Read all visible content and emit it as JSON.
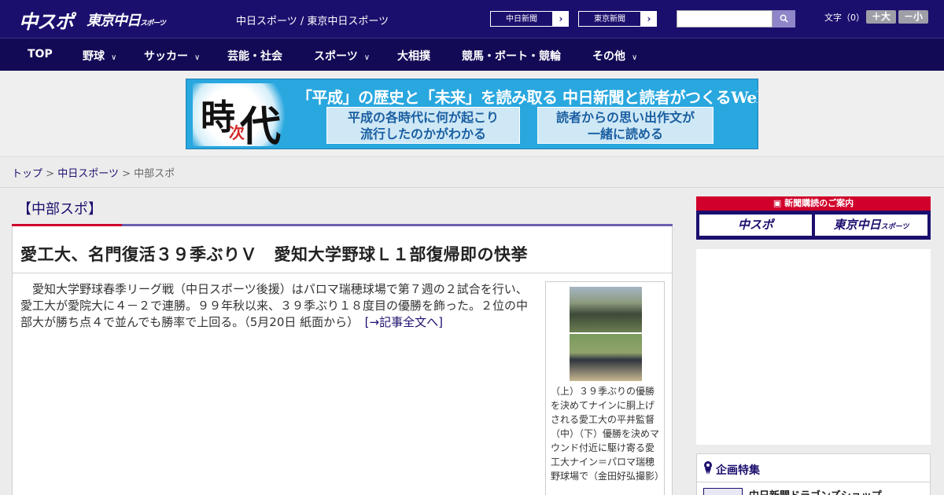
{
  "header": {
    "logo_chuspo": "中スポ",
    "logo_tokyo": "東京中日",
    "logo_tokyo_sub": "スポーツ",
    "site_names": "中日スポーツ / 東京中日スポーツ",
    "paper1_label": "中日新聞",
    "paper2_label": "東京新聞",
    "search_placeholder": "",
    "fontsize_label": "文字（0）",
    "font_bigger": "＋大",
    "font_smaller": "－小"
  },
  "nav": {
    "items": [
      "TOP",
      "野球",
      "サッカー",
      "芸能・社会",
      "スポーツ",
      "大相撲",
      "競馬・ボート・競輪",
      "その他"
    ]
  },
  "banner": {
    "ji": "時",
    "tsugi": "次",
    "dai": "代",
    "headline": "「平成」の歴史と「未来」を読み取る 中日新聞と読者がつくるWebサイト",
    "box1_line1": "平成の各時代に何が起こり",
    "box1_line2": "流行したのかがわかる",
    "box2_line1": "読者からの思い出作文が",
    "box2_line2": "一緒に読める"
  },
  "breadcrumb": {
    "top": "トップ",
    "sep": ">",
    "section": "中日スポーツ",
    "current": "中部スポ"
  },
  "article": {
    "category": "【中部スポ】",
    "headline": "愛工大、名門復活３９季ぶりＶ　愛知大学野球Ｌ１部復帰即の快挙",
    "body": "愛知大学野球春季リーグ戦（中日スポーツ後援）はパロマ瑞穂球場で第７週の２試合を行い、愛工大が愛院大に４－２で連勝。９９年秋以来、３９季ぶり１８度目の優勝を飾った。２位の中部大が勝ち点４で並んでも勝率で上回る。（5月20日 紙面から）",
    "more_link": "[→記事全文へ]",
    "caption": "（上）３９季ぶりの優勝を決めてナインに胴上げされる愛工大の平井監督（中）（下）優勝を決めマウンド付近に駆け寄る愛工大ナイン＝パロマ瑞穂野球場で（金田好弘撮影）"
  },
  "sidebar": {
    "subscribe_head": "新聞購読のご案内",
    "sub_btn1": "中スポ",
    "sub_btn2": "東京中日",
    "sub_btn2_small": "スポーツ",
    "feature_title": "企画特集",
    "feature_item": "中日新聞ドラゴンズショップ"
  },
  "colors": {
    "header_bg": "#1b0f6e",
    "nav_bg": "#120a55",
    "accent_red": "#d0002a",
    "banner_blue": "#29a7df"
  }
}
